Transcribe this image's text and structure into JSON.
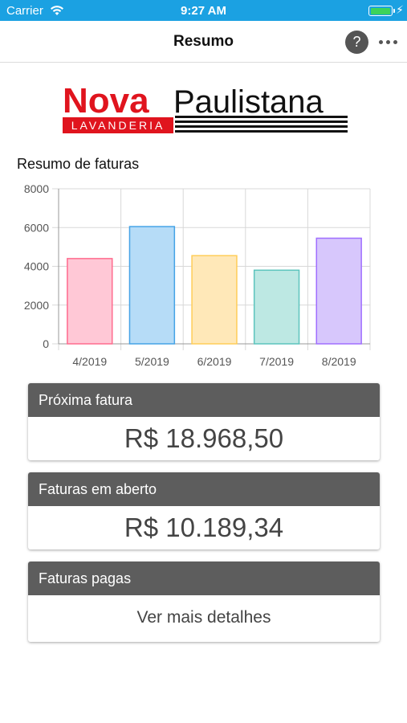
{
  "status_bar": {
    "carrier": "Carrier",
    "time": "9:27 AM",
    "battery_level": 1.0,
    "battery_color": "#3cd35a",
    "background": "#1ba1e2"
  },
  "nav": {
    "title": "Resumo",
    "help_label": "?",
    "more_icon": "ellipsis-icon"
  },
  "logo": {
    "word1": "Nova",
    "word2": "Paulistana",
    "subtitle": "LAVANDERIA",
    "brand_red": "#e0141e"
  },
  "summary": {
    "title": "Resumo de faturas"
  },
  "chart_data": {
    "type": "bar",
    "categories": [
      "4/2019",
      "5/2019",
      "6/2019",
      "7/2019",
      "8/2019"
    ],
    "values": [
      4400,
      6050,
      4550,
      3800,
      5450
    ],
    "ylim": [
      0,
      8000
    ],
    "yticks": [
      "8000",
      "6000",
      "4000",
      "2000",
      "0"
    ],
    "grid": true,
    "fill_colors": [
      "#ffc8d6",
      "#b6dcf7",
      "#ffe8b8",
      "#bde8e3",
      "#d7c7fc"
    ],
    "stroke_colors": [
      "#ff6b8e",
      "#45a3e6",
      "#ffcd58",
      "#5cc4bd",
      "#a06eff"
    ]
  },
  "cards": [
    {
      "header": "Próxima fatura",
      "value": "R$ 18.968,50"
    },
    {
      "header": "Faturas em aberto",
      "value": "R$ 10.189,34"
    },
    {
      "header": "Faturas pagas",
      "link": "Ver mais detalhes"
    }
  ]
}
